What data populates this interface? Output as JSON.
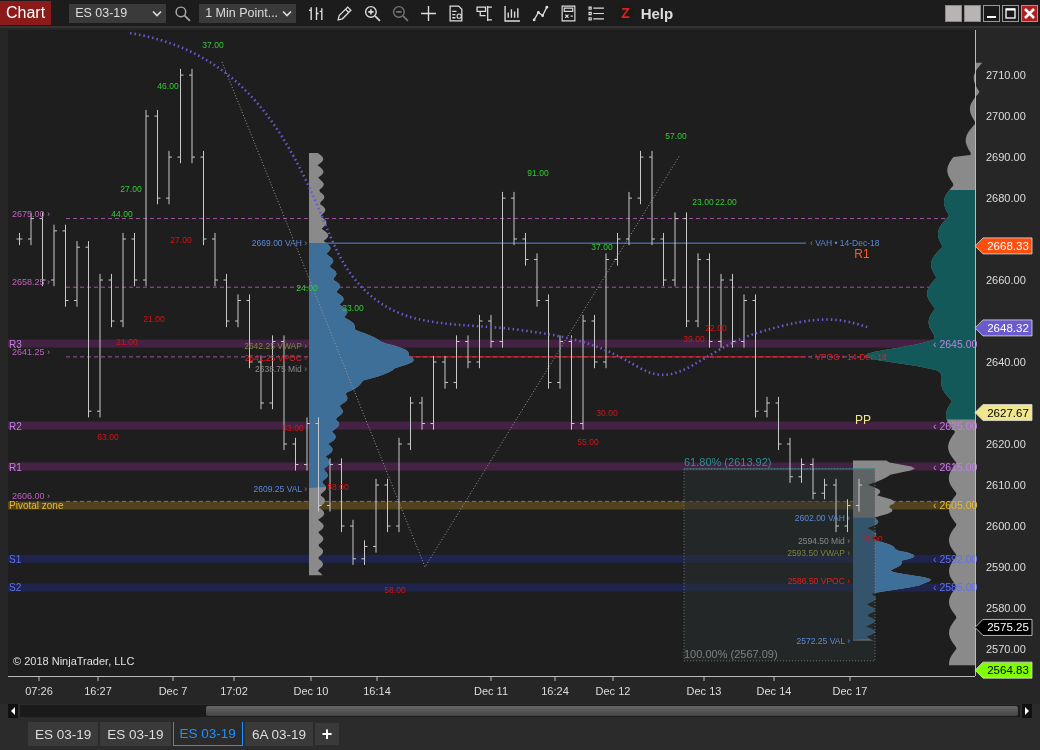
{
  "toolbar": {
    "title": "Chart",
    "instrument": "ES 03-19",
    "interval": "1 Min Point...",
    "logo": "Z",
    "help": "Help"
  },
  "chart": {
    "copyright": "© 2018 NinjaTrader, LLC",
    "price_axis": [
      "2710.00",
      "2700.00",
      "2690.00",
      "2680.00",
      "2660.00",
      "2640.00",
      "2620.00",
      "2610.00",
      "2600.00",
      "2590.00",
      "2580.00",
      "2570.00"
    ],
    "time_axis": [
      "07:26",
      "16:27",
      "Dec 7",
      "17:02",
      "Dec 10",
      "16:14",
      "Dec 11",
      "16:24",
      "Dec 12",
      "Dec 13",
      "Dec 14",
      "Dec 17"
    ],
    "zones": [
      {
        "text": "R3",
        "kind": "resistance"
      },
      {
        "text": "R2",
        "kind": "resistance"
      },
      {
        "text": "R1",
        "kind": "resistance"
      },
      {
        "text": "Pivotal zone",
        "kind": "pivot"
      },
      {
        "text": "S1",
        "kind": "support"
      },
      {
        "text": "S2",
        "kind": "support"
      }
    ],
    "zone_prices": [
      {
        "text": "‹ 2645.00",
        "kind": "resistance"
      },
      {
        "text": "‹ 2625.00",
        "kind": "resistance"
      },
      {
        "text": "‹ 2615.00",
        "kind": "resistance"
      },
      {
        "text": "‹ 2605.00",
        "kind": "pivot"
      },
      {
        "text": "‹ 2592.00",
        "kind": "support"
      },
      {
        "text": "‹ 2585.00",
        "kind": "support"
      }
    ],
    "levels": [
      "2675.00 ›",
      "2658.25 ›",
      "2641.25 ›",
      "2606.00 ›"
    ],
    "trade_counts": [
      {
        "text": "37.00",
        "kind": "high"
      },
      {
        "text": "46.00",
        "kind": "high"
      },
      {
        "text": "27.00",
        "kind": "high"
      },
      {
        "text": "44.00",
        "kind": "high"
      },
      {
        "text": "27.00",
        "kind": "low"
      },
      {
        "text": "21.00",
        "kind": "low"
      },
      {
        "text": "21.00",
        "kind": "low"
      },
      {
        "text": "63.00",
        "kind": "low"
      },
      {
        "text": "24.00",
        "kind": "high"
      },
      {
        "text": "33.00",
        "kind": "high"
      },
      {
        "text": "83.00",
        "kind": "low"
      },
      {
        "text": "58.00",
        "kind": "low"
      },
      {
        "text": "58.00",
        "kind": "low"
      },
      {
        "text": "91.00",
        "kind": "high"
      },
      {
        "text": "37.00",
        "kind": "high"
      },
      {
        "text": "57.00",
        "kind": "high"
      },
      {
        "text": "23.00",
        "kind": "high"
      },
      {
        "text": "22.00",
        "kind": "high"
      },
      {
        "text": "39.00",
        "kind": "low"
      },
      {
        "text": "22.00",
        "kind": "low"
      },
      {
        "text": "30.00",
        "kind": "low"
      },
      {
        "text": "55.00",
        "kind": "low"
      },
      {
        "text": "15.00",
        "kind": "low"
      }
    ],
    "profile_labels": [
      {
        "text": "2669.00 VAH ›",
        "kind": "vah"
      },
      {
        "text": "2642.25 VWAP ›",
        "kind": "vwap"
      },
      {
        "text": "2641.25 VPOC ›",
        "kind": "vpoc"
      },
      {
        "text": "2638.75 Mid ›",
        "kind": "mid"
      },
      {
        "text": "2609.25 VAL ›",
        "kind": "val"
      },
      {
        "text": "2602.00 VAH ›",
        "kind": "vah"
      },
      {
        "text": "2594.50 Mid ›",
        "kind": "mid"
      },
      {
        "text": "2593.50 VWAP ›",
        "kind": "vwap"
      },
      {
        "text": "2586.50 VPOC ›",
        "kind": "vpoc"
      },
      {
        "text": "2572.25 VAL ›",
        "kind": "val"
      }
    ],
    "naked_levels": [
      {
        "text": "‹ VAH • 14-Dec-18",
        "kind": "vah"
      },
      {
        "text": "‹ VPOC • 14-Dec-18",
        "kind": "vpoc"
      }
    ],
    "pivots": [
      {
        "text": "R1",
        "kind": "resistance"
      },
      {
        "text": "PP",
        "kind": "pivot"
      }
    ],
    "fib_labels": [
      {
        "text": "61.80% (2613.92)",
        "kind": "retracement"
      },
      {
        "text": "100.00% (2567.09)",
        "kind": "anchor"
      }
    ],
    "price_tags": [
      {
        "text": "2668.33",
        "color": "#ff4f0f"
      },
      {
        "text": "2648.32",
        "color": "#6a5acd"
      },
      {
        "text": "2627.67",
        "color": "#f0e68c"
      },
      {
        "text": "2575.25",
        "color": "#000000"
      },
      {
        "text": "2564.83",
        "color": "#7fff00"
      }
    ]
  },
  "tabs": [
    {
      "label": "ES 03-19",
      "selected": false
    },
    {
      "label": "ES 03-19",
      "selected": false
    },
    {
      "label": "ES 03-19",
      "selected": true
    },
    {
      "label": "6A 03-19",
      "selected": false
    }
  ],
  "add_tab": "+"
}
